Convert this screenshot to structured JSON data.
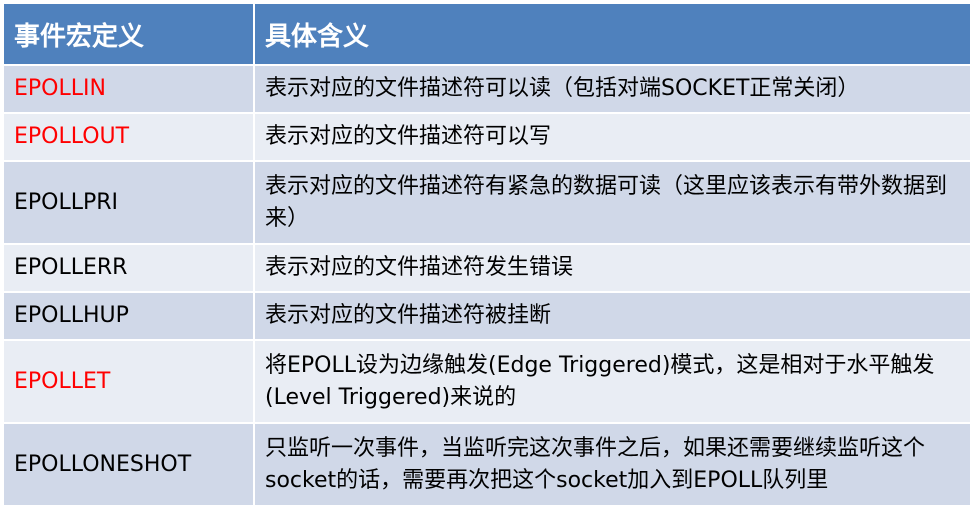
{
  "table": {
    "headers": [
      "事件宏定义",
      "具体含义"
    ],
    "rows": [
      {
        "macro": "EPOLLIN",
        "meaning": "表示对应的文件描述符可以读（包括对端SOCKET正常关闭）",
        "highlight": true
      },
      {
        "macro": "EPOLLOUT",
        "meaning": "表示对应的文件描述符可以写",
        "highlight": true
      },
      {
        "macro": "EPOLLPRI",
        "meaning": "表示对应的文件描述符有紧急的数据可读（这里应该表示有带外数据到来）",
        "highlight": false
      },
      {
        "macro": "EPOLLERR",
        "meaning": "表示对应的文件描述符发生错误",
        "highlight": false
      },
      {
        "macro": "EPOLLHUP",
        "meaning": "表示对应的文件描述符被挂断",
        "highlight": false
      },
      {
        "macro": "EPOLLET",
        "meaning": "将EPOLL设为边缘触发(Edge Triggered)模式，这是相对于水平触发(Level Triggered)来说的",
        "highlight": true
      },
      {
        "macro": "EPOLLONESHOT",
        "meaning": "只监听一次事件，当监听完这次事件之后，如果还需要继续监听这个socket的话，需要再次把这个socket加入到EPOLL队列里",
        "highlight": false
      }
    ]
  },
  "colors": {
    "header_bg": "#4f81bd",
    "header_text": "#ffffff",
    "row_odd_bg": "#d0d8e8",
    "row_even_bg": "#e9edf4",
    "highlight_text": "#ff0000"
  }
}
